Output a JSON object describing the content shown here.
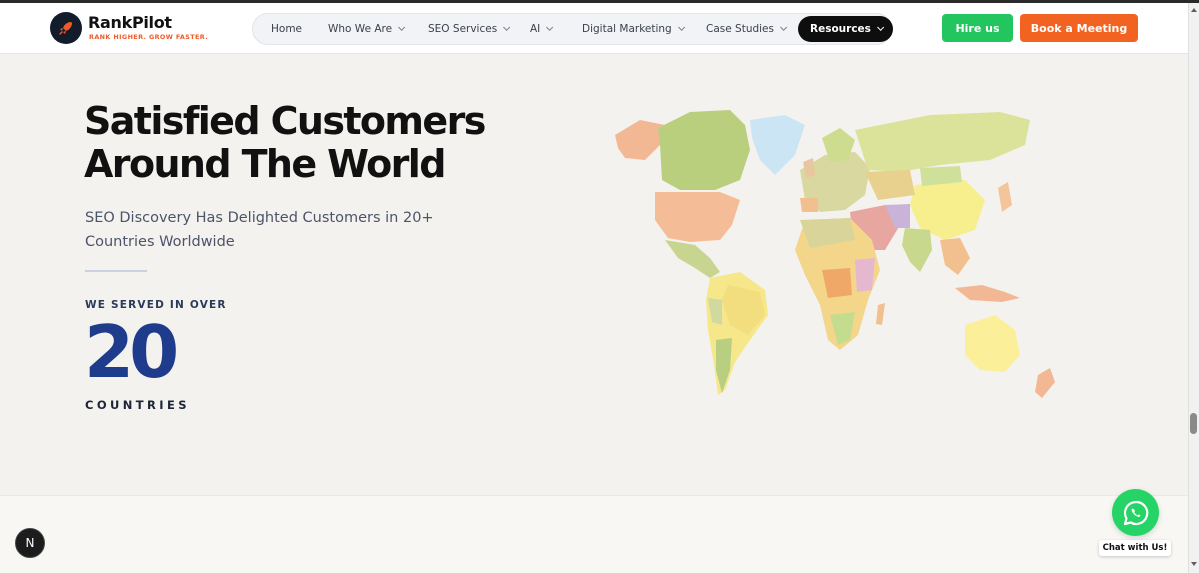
{
  "brand": {
    "name": "RankPilot",
    "tagline": "RANK HIGHER. GROW FASTER.",
    "logo_icon": "rocket-icon",
    "accent": "#f05a28"
  },
  "nav": {
    "items": [
      {
        "label": "Home",
        "has_dropdown": false
      },
      {
        "label": "Who We Are",
        "has_dropdown": true
      },
      {
        "label": "SEO Services",
        "has_dropdown": true
      },
      {
        "label": "AI",
        "has_dropdown": true
      },
      {
        "label": "Digital Marketing",
        "has_dropdown": true
      },
      {
        "label": "Case Studies",
        "has_dropdown": true
      },
      {
        "label": "Resources",
        "has_dropdown": true,
        "active": true
      }
    ]
  },
  "actions": {
    "hire_label": "Hire us",
    "hire_color": "#22c55e",
    "book_label": "Book a Meeting",
    "book_color": "#f26322"
  },
  "hero": {
    "headline_line1": "Satisfied Customers",
    "headline_line2": "Around The World",
    "subline": "SEO Discovery Has Delighted Customers in 20+ Countries Worldwide",
    "served_label": "WE SERVED IN OVER",
    "count": "20",
    "count_unit": "COUNTRIES",
    "count_color": "#1f3b8c"
  },
  "floating": {
    "badge_letter": "N",
    "whatsapp_icon": "whatsapp-icon",
    "chat_label": "Chat with Us!"
  }
}
